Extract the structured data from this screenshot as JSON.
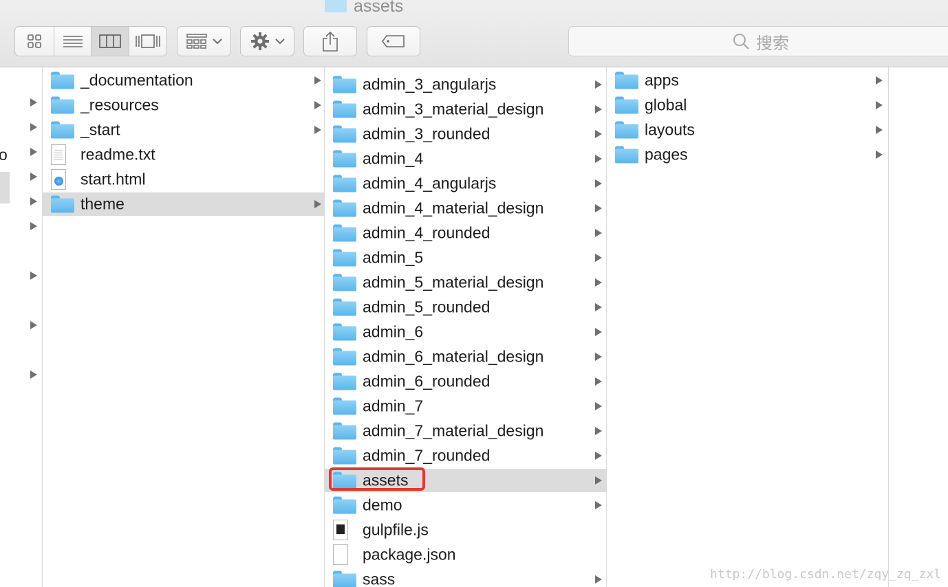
{
  "window": {
    "title": "assets",
    "search_placeholder": "搜索"
  },
  "toolbar": {
    "view_buttons": [
      "icon-view-icon",
      "list-view-icon",
      "column-view-icon",
      "cover-flow-view-icon"
    ],
    "active_view": "column-view-icon"
  },
  "column0": {
    "partial_label": "o"
  },
  "column1": {
    "items": [
      {
        "name": "_documentation",
        "kind": "folder"
      },
      {
        "name": "_resources",
        "kind": "folder"
      },
      {
        "name": "_start",
        "kind": "folder"
      },
      {
        "name": "readme.txt",
        "kind": "file-txt"
      },
      {
        "name": "start.html",
        "kind": "file-html"
      },
      {
        "name": "theme",
        "kind": "folder",
        "selected": true
      }
    ]
  },
  "column2": {
    "items": [
      {
        "name": "admin_3_angularjs",
        "kind": "folder"
      },
      {
        "name": "admin_3_material_design",
        "kind": "folder"
      },
      {
        "name": "admin_3_rounded",
        "kind": "folder"
      },
      {
        "name": "admin_4",
        "kind": "folder"
      },
      {
        "name": "admin_4_angularjs",
        "kind": "folder"
      },
      {
        "name": "admin_4_material_design",
        "kind": "folder"
      },
      {
        "name": "admin_4_rounded",
        "kind": "folder"
      },
      {
        "name": "admin_5",
        "kind": "folder"
      },
      {
        "name": "admin_5_material_design",
        "kind": "folder"
      },
      {
        "name": "admin_5_rounded",
        "kind": "folder"
      },
      {
        "name": "admin_6",
        "kind": "folder"
      },
      {
        "name": "admin_6_material_design",
        "kind": "folder"
      },
      {
        "name": "admin_6_rounded",
        "kind": "folder"
      },
      {
        "name": "admin_7",
        "kind": "folder"
      },
      {
        "name": "admin_7_material_design",
        "kind": "folder"
      },
      {
        "name": "admin_7_rounded",
        "kind": "folder"
      },
      {
        "name": "assets",
        "kind": "folder",
        "selected": true
      },
      {
        "name": "demo",
        "kind": "folder"
      },
      {
        "name": "gulpfile.js",
        "kind": "file-js"
      },
      {
        "name": "package.json",
        "kind": "file-plain"
      },
      {
        "name": "sass",
        "kind": "folder"
      }
    ]
  },
  "column3": {
    "items": [
      {
        "name": "apps",
        "kind": "folder"
      },
      {
        "name": "global",
        "kind": "folder"
      },
      {
        "name": "layouts",
        "kind": "folder"
      },
      {
        "name": "pages",
        "kind": "folder"
      }
    ]
  },
  "highlight_color": "#e03a30",
  "watermark": "http://blog.csdn.net/zqy_zq_zxl"
}
